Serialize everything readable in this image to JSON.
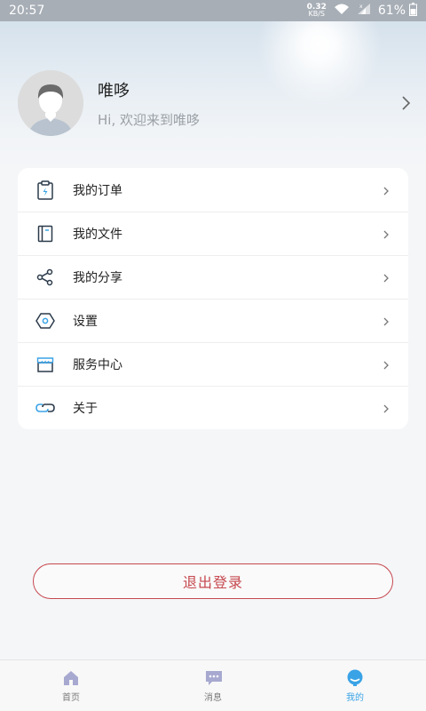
{
  "status_bar": {
    "time": "20:57",
    "net_speed_value": "0.32",
    "net_speed_unit": "KB/S",
    "battery": "61%"
  },
  "profile": {
    "name": "唯哆",
    "subtitle": "Hi, 欢迎来到唯哆"
  },
  "menu": {
    "items": [
      {
        "label": "我的订单",
        "icon": "clipboard-icon"
      },
      {
        "label": "我的文件",
        "icon": "notebook-icon"
      },
      {
        "label": "我的分享",
        "icon": "share-icon"
      },
      {
        "label": "设置",
        "icon": "settings-hexagon-icon"
      },
      {
        "label": "服务中心",
        "icon": "store-icon"
      },
      {
        "label": "关于",
        "icon": "link-icon"
      }
    ]
  },
  "logout": {
    "label": "退出登录"
  },
  "tabbar": {
    "tabs": [
      {
        "label": "首页",
        "icon": "home-icon"
      },
      {
        "label": "消息",
        "icon": "message-icon"
      },
      {
        "label": "我的",
        "icon": "profile-icon"
      }
    ]
  },
  "colors": {
    "accent": "#3aa3e6",
    "logout": "#c6484f",
    "icon_stroke": "#2b3a4a"
  }
}
